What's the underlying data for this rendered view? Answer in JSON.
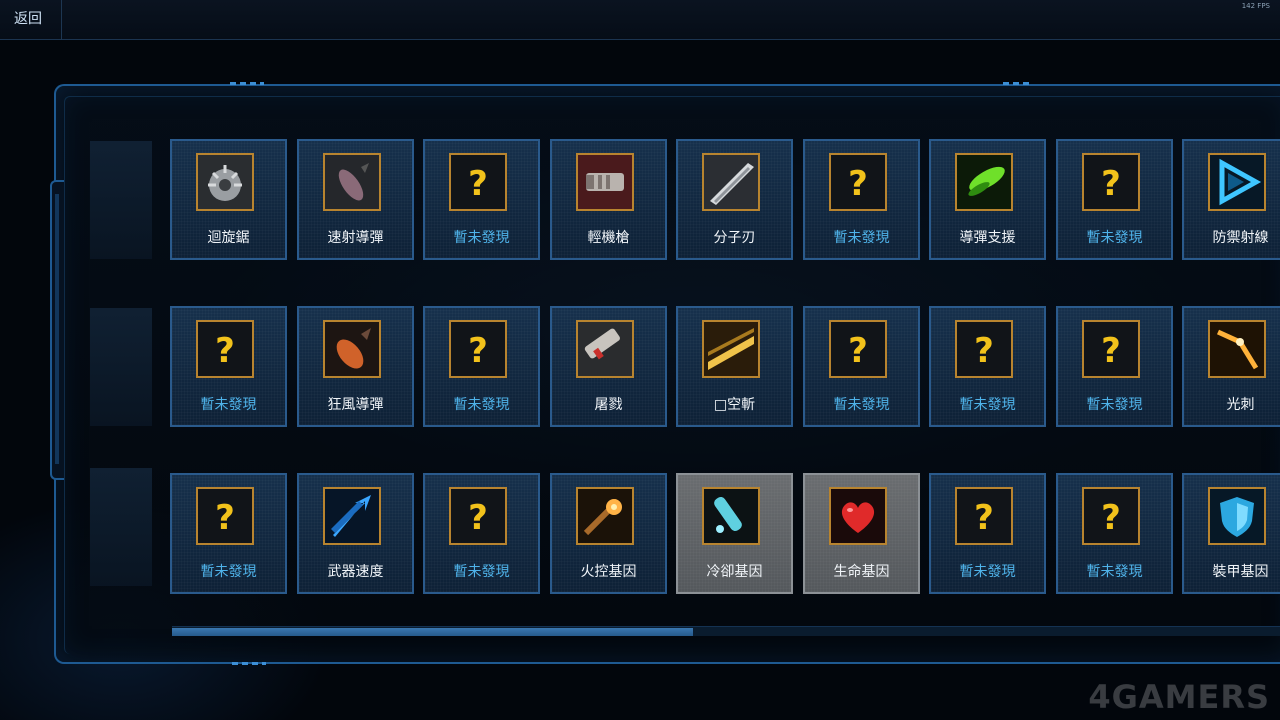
{
  "topbar": {
    "back_label": "返回",
    "fps": "142 FPS"
  },
  "watermark": "4GAMERS",
  "scroll": {
    "position": 0.47
  },
  "rows": [
    [
      {
        "label": "迴旋鋸",
        "known": true,
        "icon": "sawblade-icon"
      },
      {
        "label": "速射導彈",
        "known": true,
        "icon": "missile-icon"
      },
      {
        "label": "暫未發現",
        "known": false,
        "icon": "unknown-icon"
      },
      {
        "label": "輕機槍",
        "known": true,
        "icon": "machine-gun-icon"
      },
      {
        "label": "分子刃",
        "known": true,
        "icon": "blade-icon"
      },
      {
        "label": "暫未發現",
        "known": false,
        "icon": "unknown-icon"
      },
      {
        "label": "導彈支援",
        "known": true,
        "icon": "green-missile-icon"
      },
      {
        "label": "暫未發現",
        "known": false,
        "icon": "unknown-icon"
      },
      {
        "label": "防禦射線",
        "known": true,
        "icon": "blue-triangle-icon"
      }
    ],
    [
      {
        "label": "暫未發現",
        "known": false,
        "icon": "unknown-icon"
      },
      {
        "label": "狂風導彈",
        "known": true,
        "icon": "orange-missile-icon"
      },
      {
        "label": "暫未發現",
        "known": false,
        "icon": "unknown-icon"
      },
      {
        "label": "屠戮",
        "known": true,
        "icon": "cannon-icon"
      },
      {
        "label": "□空斬",
        "known": true,
        "icon": "gold-blade-icon"
      },
      {
        "label": "暫未發現",
        "known": false,
        "icon": "unknown-icon"
      },
      {
        "label": "暫未發現",
        "known": false,
        "icon": "unknown-icon"
      },
      {
        "label": "暫未發現",
        "known": false,
        "icon": "unknown-icon"
      },
      {
        "label": "光刺",
        "known": true,
        "icon": "light-spike-icon"
      }
    ],
    [
      {
        "label": "暫未發現",
        "known": false,
        "icon": "unknown-icon"
      },
      {
        "label": "武器速度",
        "known": true,
        "icon": "speed-arrow-icon"
      },
      {
        "label": "暫未發現",
        "known": false,
        "icon": "unknown-icon"
      },
      {
        "label": "火控基因",
        "known": true,
        "icon": "fire-control-icon"
      },
      {
        "label": "冷卻基因",
        "known": true,
        "icon": "cooling-vial-icon",
        "selected": true
      },
      {
        "label": "生命基因",
        "known": true,
        "icon": "heart-icon",
        "selected": true
      },
      {
        "label": "暫未發現",
        "known": false,
        "icon": "unknown-icon"
      },
      {
        "label": "暫未發現",
        "known": false,
        "icon": "unknown-icon"
      },
      {
        "label": "裝甲基因",
        "known": true,
        "icon": "shield-icon"
      }
    ]
  ]
}
